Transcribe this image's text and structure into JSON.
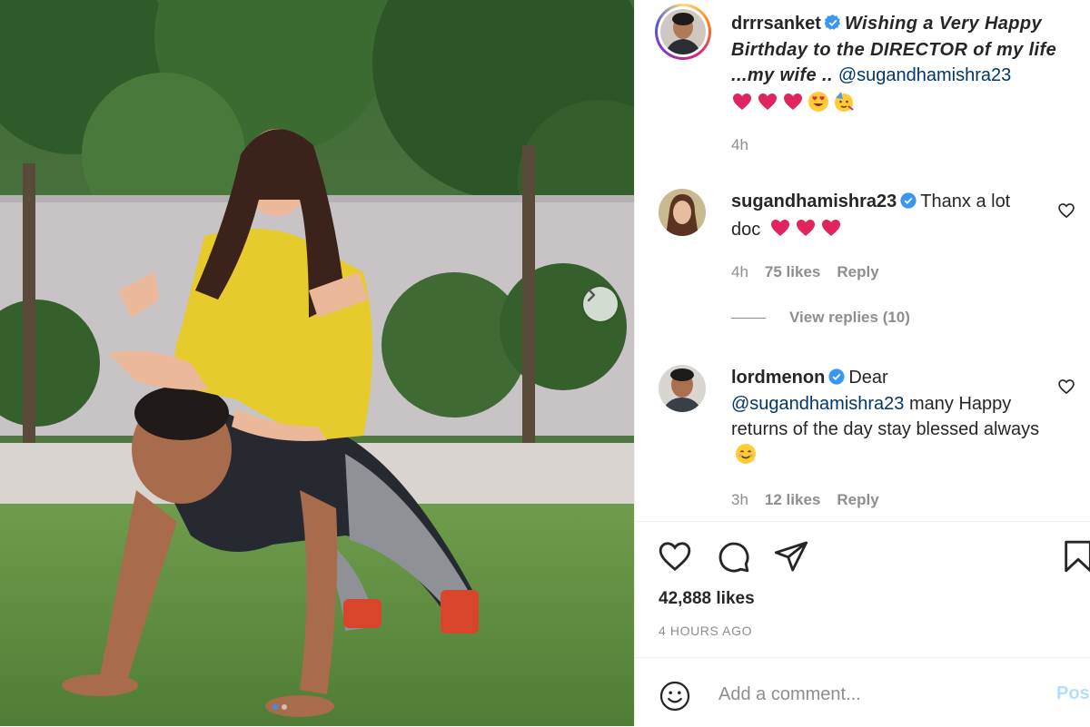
{
  "post": {
    "photo_description": "",
    "carousel": {
      "dot_count": 2,
      "active_index": 0
    }
  },
  "caption": {
    "username": "drrrsanket",
    "text": "Wishing a Very Happy Birthday to the DIRECTOR of my life ...my wife .. ",
    "mention": "@sugandhamishra23",
    "time": "4h"
  },
  "comments": [
    {
      "username": "sugandhamishra23",
      "text": "Thanx a lot doc",
      "time": "4h",
      "likes": "75 likes",
      "reply": "Reply",
      "view_replies": "View replies (10)"
    },
    {
      "username": "lordmenon",
      "text_prefix": "Dear",
      "mention": "@sugandhamishra23",
      "text_suffix": " many Happy returns of the day stay blessed always",
      "time": "3h",
      "likes": "12 likes",
      "reply": "Reply"
    }
  ],
  "actions": {
    "likes": "42,888 likes",
    "date": "4 HOURS AGO"
  },
  "add_comment": {
    "placeholder": "Add a comment...",
    "post_label": "Post"
  },
  "colors": {
    "verified": "#3897f0",
    "heart_emoji": "#e0245e",
    "link": "#00376b",
    "muted": "#8e8e8e",
    "post_button": "#b2dffc"
  },
  "icons": [
    "chevron-right-icon",
    "verified-badge-icon",
    "heart-icon",
    "comment-icon",
    "share-icon",
    "bookmark-icon",
    "smiley-icon"
  ]
}
